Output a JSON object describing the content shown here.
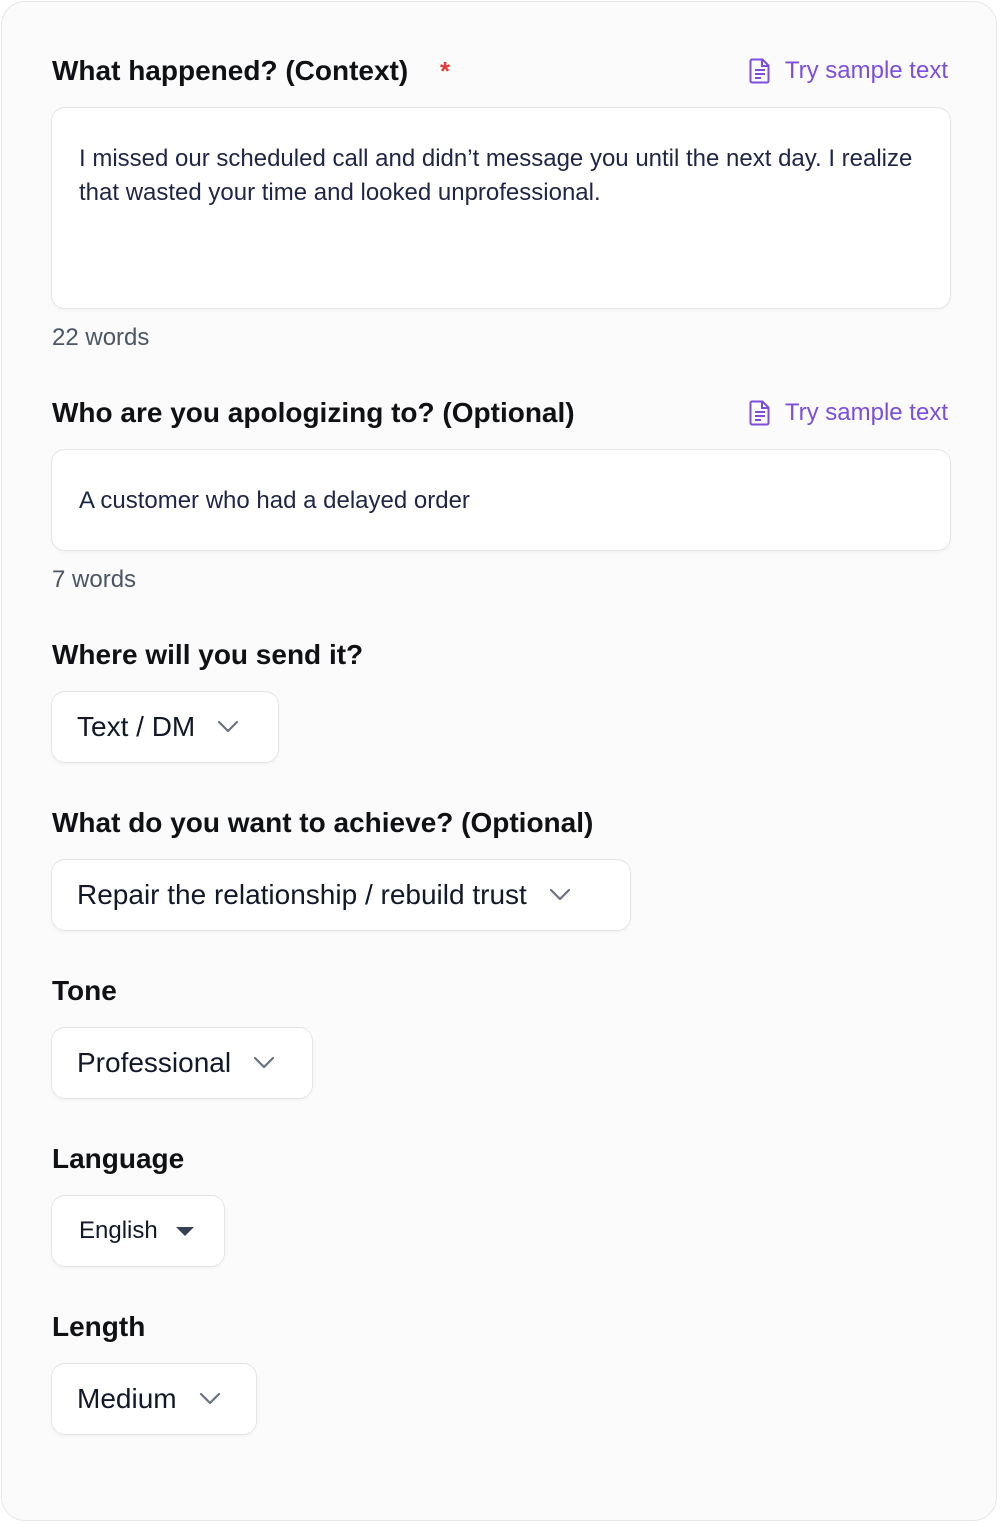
{
  "context": {
    "label": "What happened? (Context)",
    "required_mark": "*",
    "sample_link": "Try sample text",
    "value": "I missed our scheduled call and didn’t message you until the next day. I realize that wasted your time and looked unprofessional.",
    "word_count": "22 words"
  },
  "recipient": {
    "label": "Who are you apologizing to? (Optional)",
    "sample_link": "Try sample text",
    "value": "A customer who had a delayed order",
    "word_count": "7 words"
  },
  "channel": {
    "label": "Where will you send it?",
    "value": "Text / DM"
  },
  "goal": {
    "label": "What do you want to achieve? (Optional)",
    "value": "Repair the relationship / rebuild trust"
  },
  "tone": {
    "label": "Tone",
    "value": "Professional"
  },
  "language": {
    "label": "Language",
    "value": "English"
  },
  "length": {
    "label": "Length",
    "value": "Medium"
  },
  "colors": {
    "accent": "#7c4dde",
    "required": "#e23a3a",
    "input_text": "#1f2544"
  },
  "icons": {
    "sample": "document-icon",
    "dropdown": "chevron-down-icon",
    "native_dropdown": "caret-down-icon"
  }
}
